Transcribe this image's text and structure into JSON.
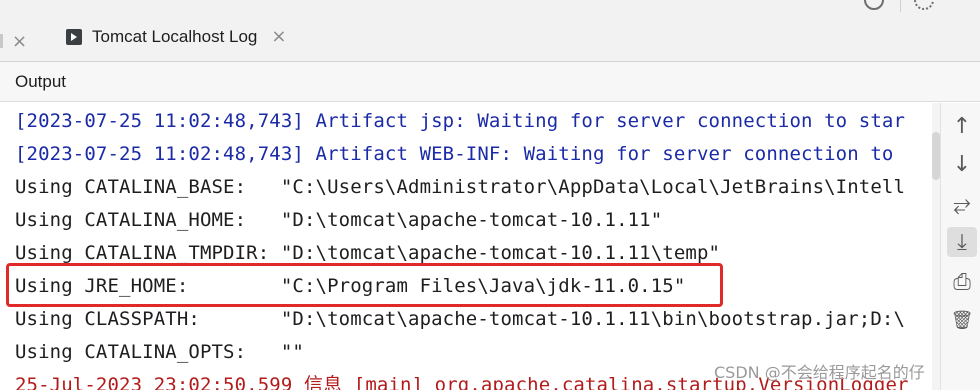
{
  "tabbar": {
    "tab_label": "Tomcat Localhost Log",
    "close_glyph": "×",
    "stub_close_glyph": "×"
  },
  "output": {
    "label": "Output"
  },
  "console": {
    "lines": [
      {
        "text": "[2023-07-25 11:02:48,743] Artifact jsp: Waiting for server connection to star",
        "color": "#1b2aa6"
      },
      {
        "text": "[2023-07-25 11:02:48,743] Artifact WEB-INF: Waiting for server connection to",
        "color": "#1b2aa6"
      },
      {
        "text": "Using CATALINA_BASE:   \"C:\\Users\\Administrator\\AppData\\Local\\JetBrains\\Intell",
        "color": "#1e1e1e"
      },
      {
        "text": "Using CATALINA_HOME:   \"D:\\tomcat\\apache-tomcat-10.1.11\"",
        "color": "#1e1e1e"
      },
      {
        "text": "Using CATALINA_TMPDIR: \"D:\\tomcat\\apache-tomcat-10.1.11\\temp\"",
        "color": "#1e1e1e"
      },
      {
        "text": "Using JRE_HOME:        \"C:\\Program Files\\Java\\jdk-11.0.15\"",
        "color": "#1e1e1e"
      },
      {
        "text": "Using CLASSPATH:       \"D:\\tomcat\\apache-tomcat-10.1.11\\bin\\bootstrap.jar;D:\\",
        "color": "#1e1e1e"
      },
      {
        "text": "Using CATALINA_OPTS:   \"\"",
        "color": "#1e1e1e"
      },
      {
        "text": "25-Jul-2023 23:02:50.599 信息 [main] org.apache.catalina.startup.VersionLogger",
        "color": "#b31b1b"
      }
    ]
  },
  "toolbar": {
    "up_icon": "↑",
    "down_icon": "↓",
    "wrap_icon": "⥂",
    "scroll_end_icon": "⤓",
    "print_icon": "⎙",
    "trash_icon": "🗑"
  },
  "watermark": {
    "text": "CSDN @不会给程序起名的仔"
  }
}
